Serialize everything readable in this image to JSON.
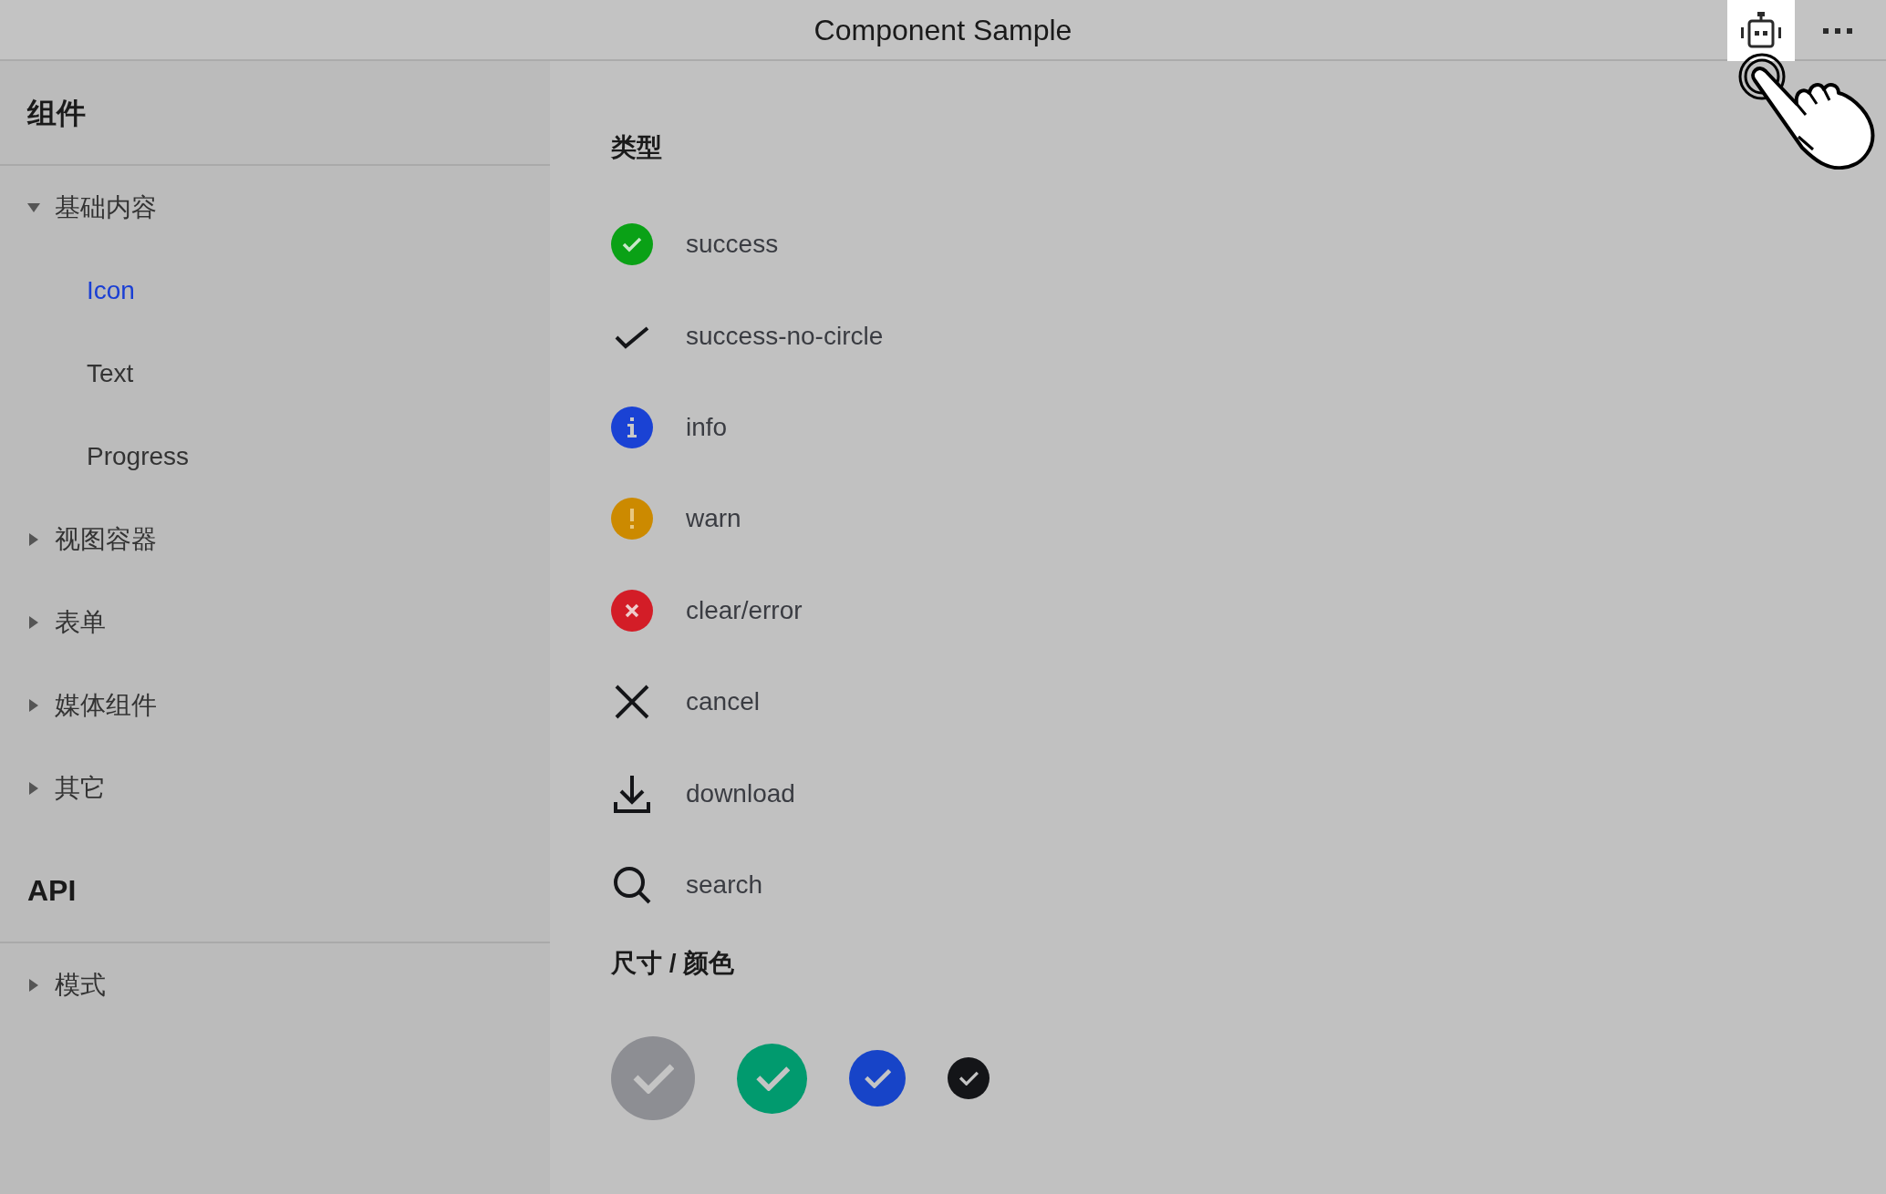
{
  "window": {
    "title": "Component Sample",
    "toolbar": [
      {
        "kind": "robot",
        "selected": true
      },
      {
        "kind": "more",
        "selected": false
      }
    ]
  },
  "sidebar": {
    "sections": [
      {
        "title": "组件",
        "groups": [
          {
            "label": "基础内容",
            "expanded": true,
            "children": [
              {
                "label": "Icon",
                "selected": true
              },
              {
                "label": "Text",
                "selected": false
              },
              {
                "label": "Progress",
                "selected": false
              }
            ]
          },
          {
            "label": "视图容器",
            "expanded": false
          },
          {
            "label": "表单",
            "expanded": false
          },
          {
            "label": "媒体组件",
            "expanded": false
          },
          {
            "label": "其它",
            "expanded": false
          }
        ]
      },
      {
        "title": "API",
        "groups": [
          {
            "label": "模式",
            "expanded": false
          }
        ]
      }
    ]
  },
  "content": {
    "types_heading": "类型",
    "types": [
      {
        "kind": "success",
        "label": "success"
      },
      {
        "kind": "success-no-circle",
        "label": "success-no-circle"
      },
      {
        "kind": "info",
        "label": "info"
      },
      {
        "kind": "warn",
        "label": "warn"
      },
      {
        "kind": "clear",
        "label": "clear/error"
      },
      {
        "kind": "cancel",
        "label": "cancel"
      },
      {
        "kind": "download",
        "label": "download"
      },
      {
        "kind": "search",
        "label": "search"
      }
    ],
    "sizes_heading": "尺寸 / 颜色",
    "swatches": [
      {
        "color": "#8d8e93"
      },
      {
        "color": "#019a6e"
      },
      {
        "color": "#1744c8"
      },
      {
        "color": "#141518"
      }
    ]
  }
}
